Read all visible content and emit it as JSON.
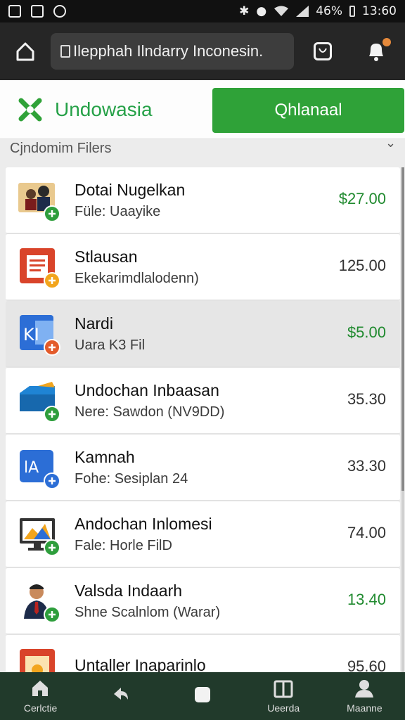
{
  "status_bar": {
    "battery": "46%",
    "time": "13:60"
  },
  "top_bar": {
    "url_text": "Ilepphah Ilndarry Inconesin."
  },
  "brand": {
    "name": "Undowasia",
    "cta_label": "Qhlanaal"
  },
  "section": {
    "label": "Cjndomim Filers"
  },
  "items": [
    {
      "title": "Dotai Nugelkan",
      "subtitle": "Füle: Uaayike",
      "price": "$27.00",
      "price_color": "#208a2f",
      "icon": "people-photo-icon",
      "badge_color": "#2e9e3c",
      "selected": false
    },
    {
      "title": "Stlausan",
      "subtitle": "Ekekarimdlalodenn)",
      "price": "125.00",
      "price_color": "#333333",
      "icon": "document-icon",
      "badge_color": "#f2a51d",
      "selected": false
    },
    {
      "title": "Nardi",
      "subtitle": "Uara K3 Fil",
      "price": "$5.00",
      "price_color": "#208a2f",
      "icon": "word-doc-icon",
      "badge_color": "#e35b2b",
      "selected": true
    },
    {
      "title": "Undochan Inbaasan",
      "subtitle": "Nere: Sawdon (NV9DD)",
      "price": "35.30",
      "price_color": "#333333",
      "icon": "folder-box-icon",
      "badge_color": "#2e9e3c",
      "selected": false
    },
    {
      "title": "Kamnah",
      "subtitle": "Fohe: Sesiplan 24",
      "price": "33.30",
      "price_color": "#333333",
      "icon": "blue-app-icon",
      "badge_color": "#2c6ed6",
      "selected": false
    },
    {
      "title": "Andochan Inlomesi",
      "subtitle": "Fale: Horle FilD",
      "price": "74.00",
      "price_color": "#333333",
      "icon": "monitor-chart-icon",
      "badge_color": "#2e9e3c",
      "selected": false
    },
    {
      "title": "Valsda Indaarh",
      "subtitle": "Shne Scalnlom (Warar)",
      "price": "13.40",
      "price_color": "#208a2f",
      "icon": "businessman-icon",
      "badge_color": "#2e9e3c",
      "selected": false
    },
    {
      "title": "Untaller Inaparinlo",
      "subtitle": "",
      "price": "95.60",
      "price_color": "#333333",
      "icon": "clipboard-icon",
      "badge_color": "#f2a51d",
      "selected": false
    }
  ],
  "bottom_nav": [
    {
      "label": "Cerlctie",
      "icon": "home-icon"
    },
    {
      "label": "",
      "icon": "back-arrow-icon"
    },
    {
      "label": "",
      "icon": "square-icon"
    },
    {
      "label": "Ueerda",
      "icon": "book-icon"
    },
    {
      "label": "Maanne",
      "icon": "person-icon"
    }
  ]
}
